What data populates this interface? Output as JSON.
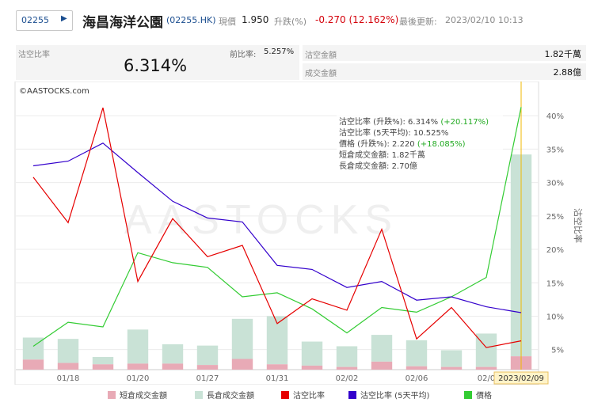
{
  "header": {
    "code_input": "02255",
    "name": "海昌海洋公園",
    "symbol": "(02255.HK)",
    "price_label": "現價",
    "price": "1.950",
    "change_label": "升跌(%)",
    "change": "-0.270 (12.162%)",
    "updated_label": "最後更新:",
    "updated": "2023/02/10 10:13"
  },
  "stats": {
    "short_ratio_label": "沽空比率",
    "short_ratio": "6.314%",
    "prev_label": "前比率:",
    "prev_value": "5.257%",
    "short_amount_label": "沽空金額",
    "short_amount": "1.82千萬",
    "turnover_label": "成交金額",
    "turnover": "2.88億"
  },
  "colors": {
    "short_turnover": "#e8aab6",
    "long_turnover": "#c9e2d6",
    "short_ratio": "#e60000",
    "short_ratio_avg": "#3300cc",
    "price": "#33cc33"
  },
  "chart_data": {
    "type": "bar",
    "source_label": "©AASTOCKS.com",
    "watermark": "AASTOCKS",
    "right_axis_title": "沽空比率",
    "ylim": [
      2,
      45
    ],
    "y_ticks": [
      5,
      10,
      15,
      20,
      25,
      30,
      35,
      40
    ],
    "y_tick_suffix": "%",
    "x_tick_labels": [
      {
        "index": 1,
        "label": "01/18"
      },
      {
        "index": 3,
        "label": "01/20"
      },
      {
        "index": 5,
        "label": "01/27"
      },
      {
        "index": 7,
        "label": "01/31"
      },
      {
        "index": 9,
        "label": "02/02"
      },
      {
        "index": 11,
        "label": "02/06"
      },
      {
        "index": 13,
        "label": "02/0"
      }
    ],
    "highlight_label": "2023/02/09",
    "grid": true,
    "legend_position": "bottom",
    "series": [
      {
        "name": "短倉成交金額",
        "type": "bar",
        "values": [
          3.5,
          3.0,
          2.8,
          2.9,
          2.9,
          2.7,
          3.6,
          2.8,
          2.6,
          2.4,
          3.2,
          2.5,
          2.4,
          2.4,
          4.0
        ]
      },
      {
        "name": "長倉成交金額",
        "type": "bar",
        "values": [
          6.8,
          6.6,
          3.9,
          8.0,
          5.8,
          5.6,
          9.6,
          10.0,
          6.2,
          5.5,
          7.2,
          6.4,
          4.9,
          7.4,
          34.2
        ]
      },
      {
        "name": "沽空比率",
        "type": "line",
        "values": [
          30.8,
          24.0,
          41.2,
          15.2,
          24.6,
          18.9,
          20.6,
          8.9,
          12.6,
          10.9,
          23.0,
          6.6,
          11.3,
          5.3,
          6.314
        ]
      },
      {
        "name": "沽空比率 (5天平均)",
        "type": "line",
        "values": [
          32.5,
          33.2,
          35.9,
          31.5,
          27.2,
          24.7,
          24.1,
          17.6,
          17.0,
          14.3,
          15.2,
          12.4,
          12.9,
          11.4,
          10.525
        ]
      },
      {
        "name": "價格",
        "type": "line",
        "values": [
          5.5,
          9.1,
          8.4,
          19.5,
          18.0,
          17.3,
          12.9,
          13.5,
          11.1,
          7.5,
          11.3,
          10.6,
          12.9,
          15.8,
          41.3
        ]
      }
    ],
    "tooltip": {
      "lines": [
        {
          "label": "沽空比率 (升跌%): ",
          "value": "6.314%",
          "extra": "(+20.117%)"
        },
        {
          "label": "沽空比率 (5天平均): ",
          "value": "10.525%",
          "extra": ""
        },
        {
          "label": "價格 (升跌%): ",
          "value": "2.220",
          "extra": "(+18.085%)"
        },
        {
          "label": "短倉成交金額: ",
          "value": "1.82千萬",
          "extra": ""
        },
        {
          "label": "長倉成交金額: ",
          "value": "2.70億",
          "extra": ""
        }
      ]
    }
  }
}
